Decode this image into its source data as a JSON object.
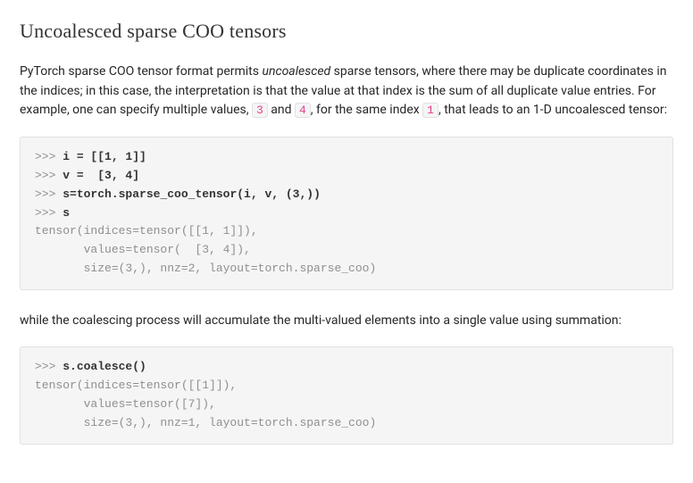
{
  "heading": "Uncoalesced sparse COO tensors",
  "para1": {
    "seg1": "PyTorch sparse COO tensor format permits ",
    "emph": "uncoalesced",
    "seg2": " sparse tensors, where there may be duplicate coordinates in the indices; in this case, the interpretation is that the value at that index is the sum of all duplicate value entries. For example, one can specify multiple values, ",
    "code1": "3",
    "seg3": " and ",
    "code2": "4",
    "seg4": ", for the same index ",
    "code3": "1",
    "seg5": ", that leads to an 1-D uncoalesced tensor:"
  },
  "codeblock1": {
    "lines": [
      {
        "prompt": ">>> ",
        "input": "i = [[1, 1]]",
        "output": ""
      },
      {
        "prompt": ">>> ",
        "input": "v =  [3, 4]",
        "output": ""
      },
      {
        "prompt": ">>> ",
        "input": "s=torch.sparse_coo_tensor(i, v, (3,))",
        "output": ""
      },
      {
        "prompt": ">>> ",
        "input": "s",
        "output": ""
      },
      {
        "prompt": "",
        "input": "",
        "output": "tensor(indices=tensor([[1, 1]]),"
      },
      {
        "prompt": "",
        "input": "",
        "output": "       values=tensor(  [3, 4]),"
      },
      {
        "prompt": "",
        "input": "",
        "output": "       size=(3,), nnz=2, layout=torch.sparse_coo)"
      }
    ]
  },
  "para2": "while the coalescing process will accumulate the multi-valued elements into a single value using summation:",
  "codeblock2": {
    "lines": [
      {
        "prompt": ">>> ",
        "input": "s.coalesce()",
        "output": ""
      },
      {
        "prompt": "",
        "input": "",
        "output": "tensor(indices=tensor([[1]]),"
      },
      {
        "prompt": "",
        "input": "",
        "output": "       values=tensor([7]),"
      },
      {
        "prompt": "",
        "input": "",
        "output": "       size=(3,), nnz=1, layout=torch.sparse_coo)"
      }
    ]
  }
}
